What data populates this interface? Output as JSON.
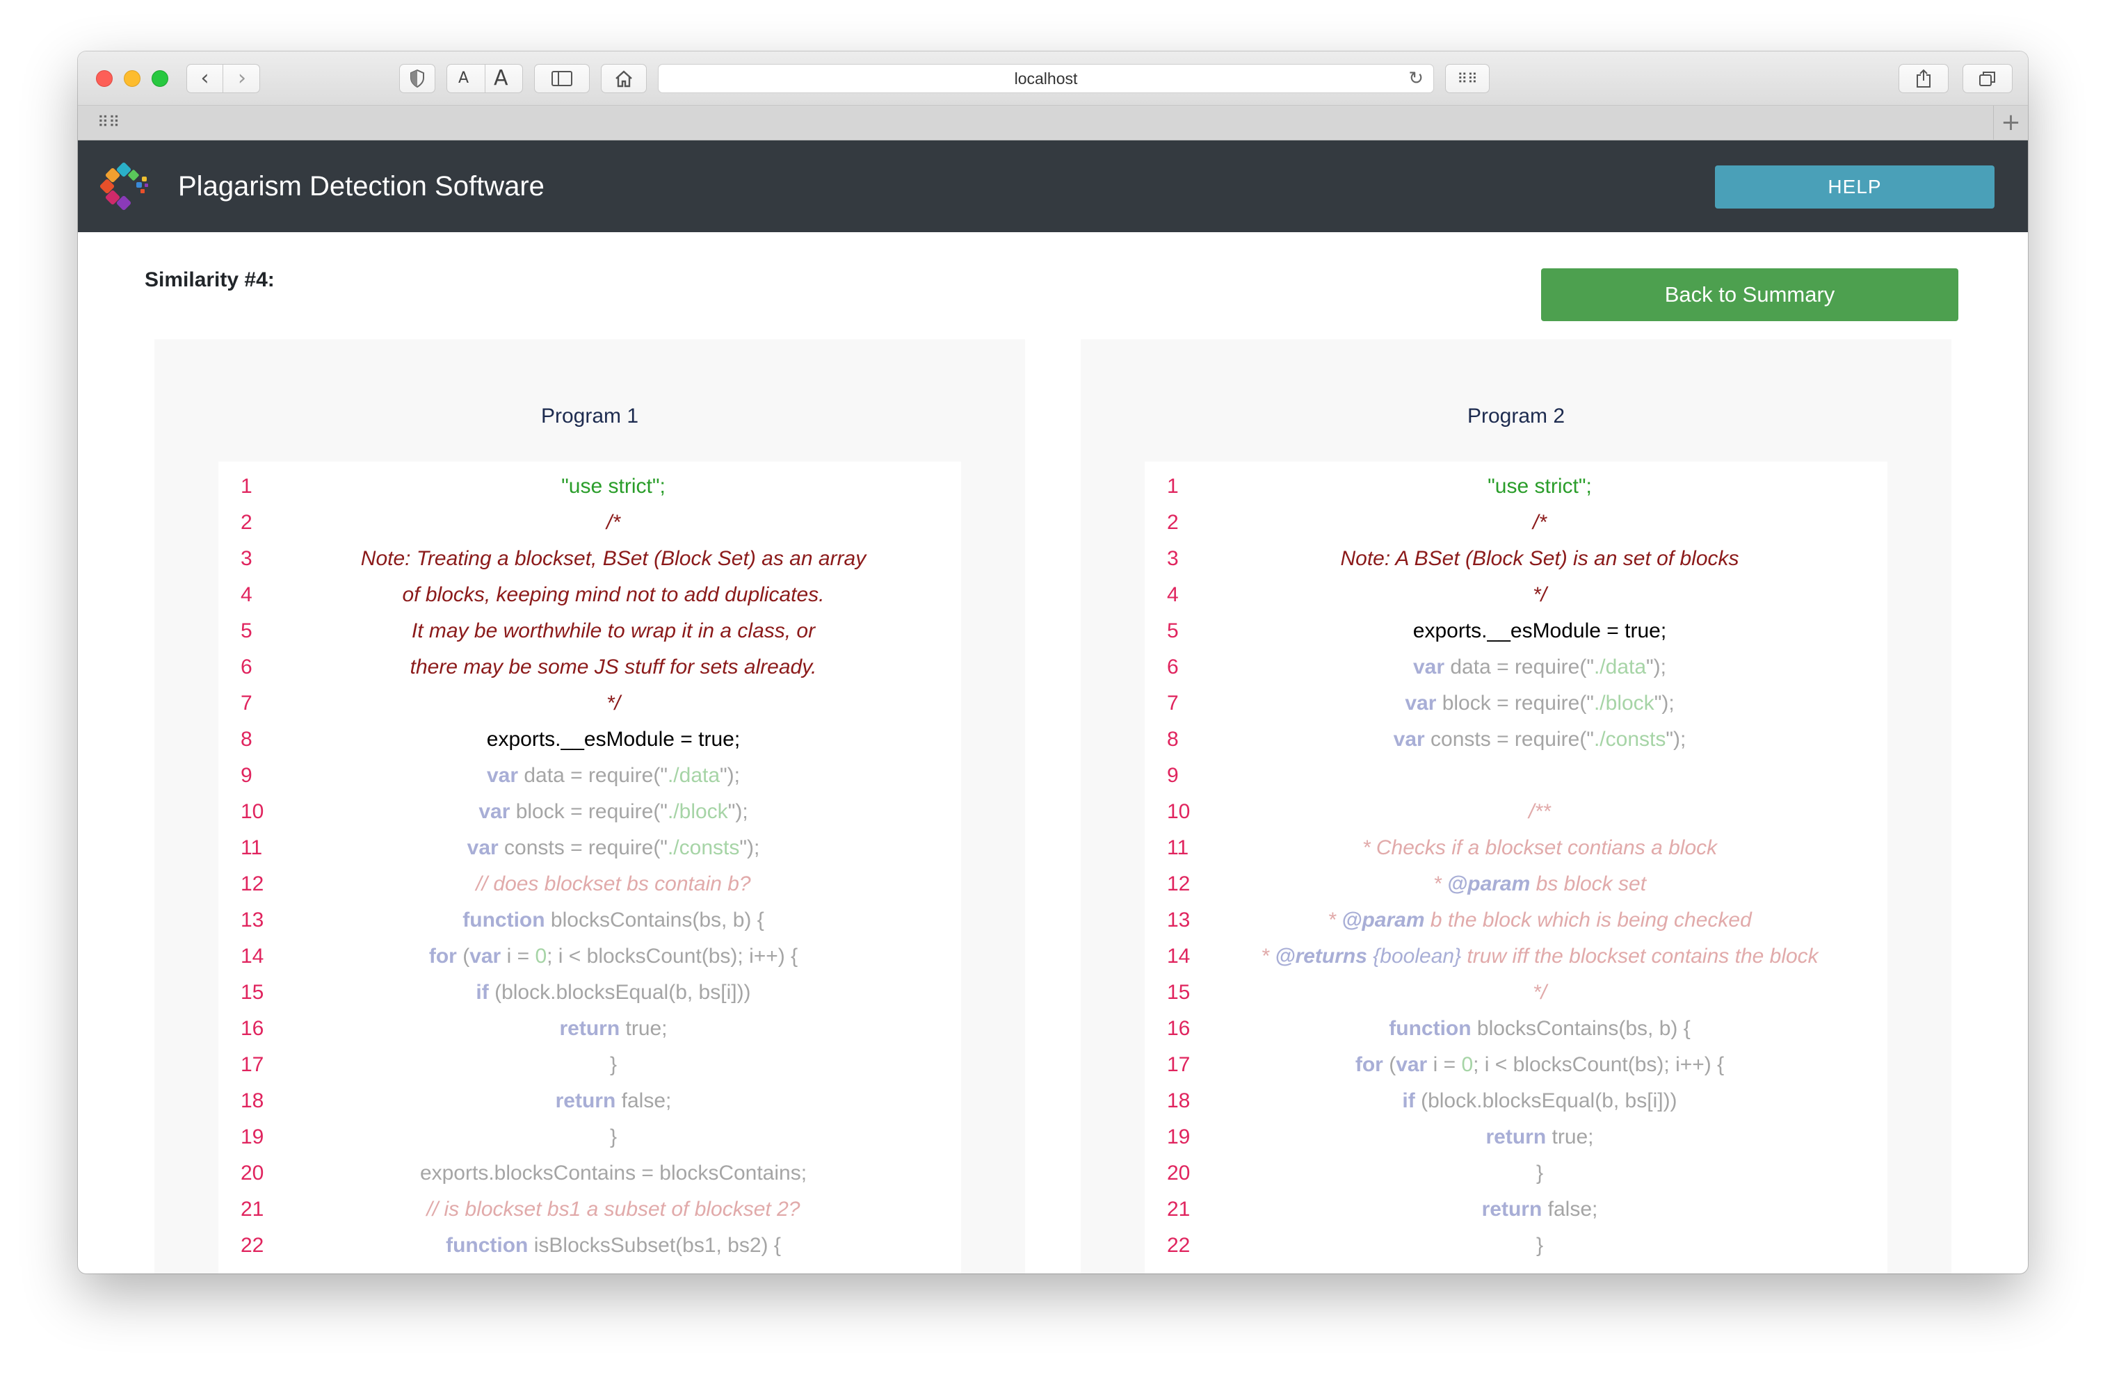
{
  "browser": {
    "url": "localhost",
    "back_icon": "chevron-left-icon",
    "forward_icon": "chevron-right-icon",
    "font_small_label": "A",
    "font_large_label": "A"
  },
  "app": {
    "title": "Plagarism Detection Software",
    "help_label": "HELP"
  },
  "page": {
    "similarity_title": "Similarity #4:",
    "back_label": "Back to Summary"
  },
  "program1": {
    "title": "Program 1",
    "lines": [
      {
        "n": "1",
        "html": "\"use strict\";",
        "style": "str"
      },
      {
        "n": "2",
        "html": "/*",
        "style": "comm"
      },
      {
        "n": "3",
        "html": "Note: Treating a blockset, BSet (Block Set) as an array",
        "style": "comm"
      },
      {
        "n": "4",
        "html": "of blocks, keeping mind not to add duplicates.",
        "style": "comm"
      },
      {
        "n": "5",
        "html": "It may be worthwhile to wrap it in a class, or",
        "style": "comm"
      },
      {
        "n": "6",
        "html": "there may be some JS stuff for sets already.",
        "style": "comm"
      },
      {
        "n": "7",
        "html": "*/",
        "style": "comm"
      },
      {
        "n": "8",
        "html": "exports.__esModule = true;",
        "style": "plain"
      },
      {
        "n": "9",
        "html": "var data = require(\"./data\");",
        "style": "faded"
      },
      {
        "n": "10",
        "html": "var block = require(\"./block\");",
        "style": "faded"
      },
      {
        "n": "11",
        "html": "var consts = require(\"./consts\");",
        "style": "faded"
      },
      {
        "n": "12",
        "html": "// does blockset bs contain b?",
        "style": "fcomm"
      },
      {
        "n": "13",
        "html": "function blocksContains(bs, b) {",
        "style": "faded"
      },
      {
        "n": "14",
        "html": "for (var i = 0; i < blocksCount(bs); i++) {",
        "style": "faded"
      },
      {
        "n": "15",
        "html": "if (block.blocksEqual(b, bs[i]))",
        "style": "faded"
      },
      {
        "n": "16",
        "html": "return true;",
        "style": "faded"
      },
      {
        "n": "17",
        "html": "}",
        "style": "faded"
      },
      {
        "n": "18",
        "html": "return false;",
        "style": "faded"
      },
      {
        "n": "19",
        "html": "}",
        "style": "faded"
      },
      {
        "n": "20",
        "html": "exports.blocksContains = blocksContains;",
        "style": "faded"
      },
      {
        "n": "21",
        "html": "// is blockset bs1 a subset of blockset 2?",
        "style": "fcomm"
      },
      {
        "n": "22",
        "html": "function isBlocksSubset(bs1, bs2) {",
        "style": "faded"
      }
    ]
  },
  "program2": {
    "title": "Program 2",
    "lines": [
      {
        "n": "1",
        "html": "\"use strict\";",
        "style": "str"
      },
      {
        "n": "2",
        "html": "/*",
        "style": "comm"
      },
      {
        "n": "3",
        "html": "Note: A BSet (Block Set) is an set of blocks",
        "style": "comm"
      },
      {
        "n": "4",
        "html": "*/",
        "style": "comm"
      },
      {
        "n": "5",
        "html": "exports.__esModule = true;",
        "style": "plain"
      },
      {
        "n": "6",
        "html": "var data = require(\"./data\");",
        "style": "faded"
      },
      {
        "n": "7",
        "html": "var block = require(\"./block\");",
        "style": "faded"
      },
      {
        "n": "8",
        "html": "var consts = require(\"./consts\");",
        "style": "faded"
      },
      {
        "n": "9",
        "html": "",
        "style": "faded"
      },
      {
        "n": "10",
        "html": "/**",
        "style": "fcomm"
      },
      {
        "n": "11",
        "html": "* Checks if a blockset contians a block",
        "style": "fcomm"
      },
      {
        "n": "12",
        "html": "* @param bs block set",
        "style": "fcomm"
      },
      {
        "n": "13",
        "html": "* @param b the block which is being checked",
        "style": "fcomm"
      },
      {
        "n": "14",
        "html": "* @returns {boolean} truw iff the blockset contains the block",
        "style": "fcomm"
      },
      {
        "n": "15",
        "html": "*/",
        "style": "fcomm"
      },
      {
        "n": "16",
        "html": "function blocksContains(bs, b) {",
        "style": "faded"
      },
      {
        "n": "17",
        "html": "for (var i = 0; i < blocksCount(bs); i++) {",
        "style": "faded"
      },
      {
        "n": "18",
        "html": "if (block.blocksEqual(b, bs[i]))",
        "style": "faded"
      },
      {
        "n": "19",
        "html": "return true;",
        "style": "faded"
      },
      {
        "n": "20",
        "html": "}",
        "style": "faded"
      },
      {
        "n": "21",
        "html": "return false;",
        "style": "faded"
      },
      {
        "n": "22",
        "html": "}",
        "style": "faded"
      }
    ]
  },
  "colors": {
    "header_bg": "#343a40",
    "help_button": "#4aa0b8",
    "back_button": "#4da04f",
    "line_number": "#e0245e",
    "string": "#2a9d2a",
    "comment": "#8b1a1a"
  }
}
